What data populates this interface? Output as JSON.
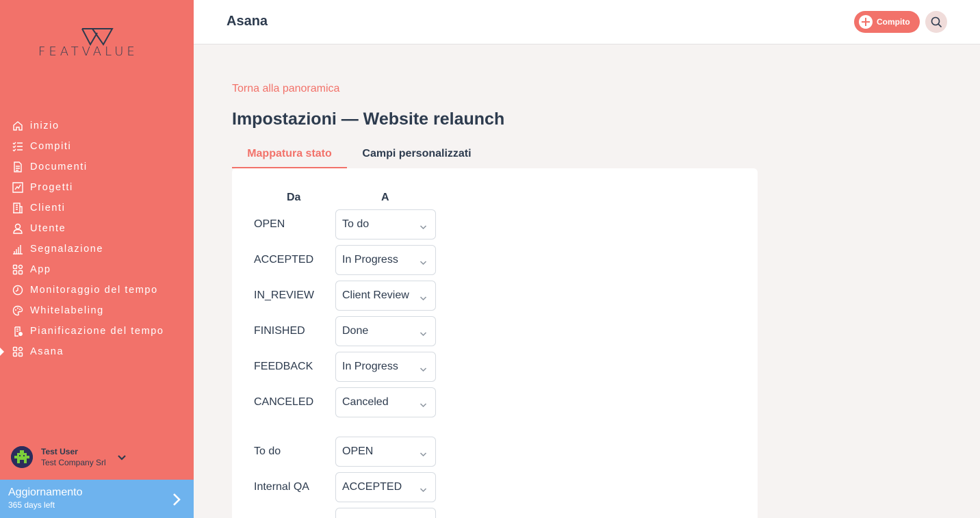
{
  "sidebar": {
    "logo_text": "FEATVALUE",
    "items": [
      {
        "label": "inizio",
        "icon": "home-icon"
      },
      {
        "label": "Compiti",
        "icon": "tasks-icon"
      },
      {
        "label": "Documenti",
        "icon": "documents-icon"
      },
      {
        "label": "Progetti",
        "icon": "projects-icon"
      },
      {
        "label": "Clienti",
        "icon": "clients-icon"
      },
      {
        "label": "Utente",
        "icon": "user-icon"
      },
      {
        "label": "Segnalazione",
        "icon": "report-icon"
      },
      {
        "label": "App",
        "icon": "apps-icon"
      },
      {
        "label": "Monitoraggio del tempo",
        "icon": "time-tracking-icon"
      },
      {
        "label": "Whitelabeling",
        "icon": "whitelabel-icon"
      },
      {
        "label": "Pianificazione del tempo",
        "icon": "time-planning-icon"
      },
      {
        "label": "Asana",
        "icon": "asana-icon",
        "active": true
      }
    ],
    "user": {
      "name": "Test User",
      "company": "Test Company Srl"
    },
    "upgrade": {
      "title": "Aggiornamento",
      "subtitle": "365 days left"
    }
  },
  "header": {
    "title": "Asana",
    "task_button": "Compito"
  },
  "main": {
    "back_link": "Torna alla panoramica",
    "title": "Impostazioni — Website relaunch",
    "tabs": [
      {
        "label": "Mappatura stato",
        "active": true
      },
      {
        "label": "Campi personalizzati",
        "active": false
      }
    ],
    "columns": {
      "from": "Da",
      "to": "A"
    },
    "mappings": [
      {
        "from": "OPEN",
        "to": "To do"
      },
      {
        "from": "ACCEPTED",
        "to": "In Progress"
      },
      {
        "from": "IN_REVIEW",
        "to": "Client Review"
      },
      {
        "from": "FINISHED",
        "to": "Done"
      },
      {
        "from": "FEEDBACK",
        "to": "In Progress"
      },
      {
        "from": "CANCELED",
        "to": "Canceled"
      },
      {
        "from": "To do",
        "to": "OPEN"
      },
      {
        "from": "Internal QA",
        "to": "ACCEPTED"
      },
      {
        "from": "",
        "to": ""
      }
    ]
  },
  "colors": {
    "accent": "#f2726a",
    "sidebar": "#f2726a",
    "upgrade": "#6eb3ee",
    "text": "#2d3b4e"
  }
}
